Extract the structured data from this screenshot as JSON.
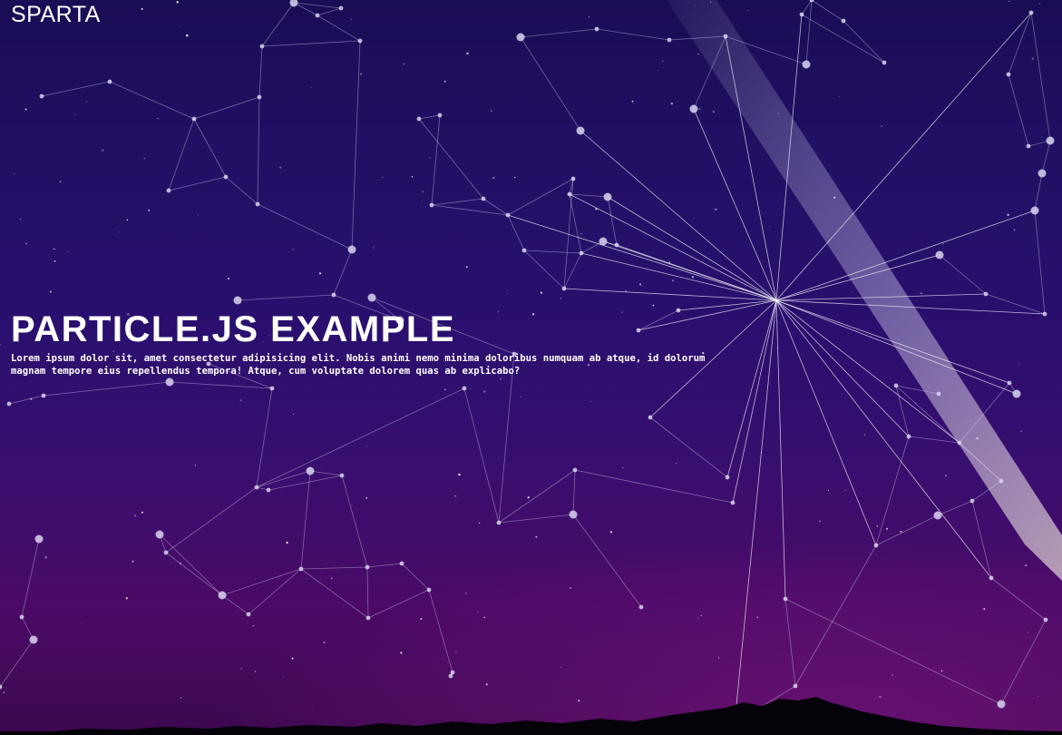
{
  "site": {
    "logo": "SPARTA"
  },
  "hero": {
    "title": "PARTICLE.JS EXAMPLE",
    "text": "Lorem ipsum dolor sit, amet consectetur adipisicing elit. Nobis animi nemo minima doloribus numquam ab atque, id dolorum magnam tempore eius repellendus tempora! Atque, cum voluptate dolorem quas ab explicabo?"
  },
  "colors": {
    "sky_top": "#1b0c55",
    "sky_bottom": "#4a0a66",
    "particles": "#d8d4f0",
    "text": "#ffffff"
  }
}
